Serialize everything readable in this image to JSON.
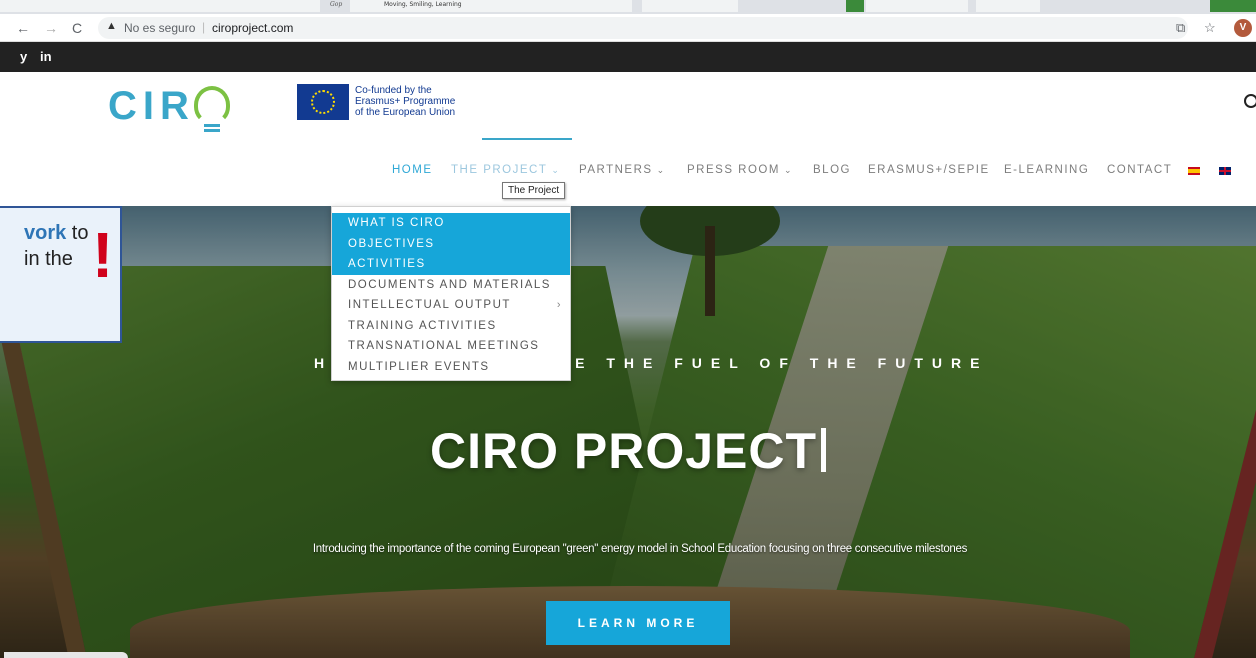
{
  "browser": {
    "tab_snippet": "Moving, Smiling, Learning",
    "tab_snippet2": "Gop",
    "back_icon": "←",
    "forward_icon": "→",
    "reload_icon": "C",
    "security_icon": "▲",
    "insecure_label": "No es seguro",
    "url_separator": "|",
    "url": "ciroproject.com",
    "translate_icon": "⧉",
    "bookmark_icon": "☆",
    "profile_initial": "V"
  },
  "social": {
    "twitter": "y",
    "linkedin": "in"
  },
  "header": {
    "logo_text": "CIR",
    "eu_line1": "Co-funded by the",
    "eu_line2": "Erasmus+ Programme",
    "eu_line3": "of the European Union"
  },
  "nav": {
    "items": [
      {
        "label": "HOME"
      },
      {
        "label": "THE PROJECT"
      },
      {
        "label": "PARTNERS"
      },
      {
        "label": "PRESS ROOM"
      },
      {
        "label": "BLOG"
      },
      {
        "label": "ERASMUS+/SEPIE"
      },
      {
        "label": "E-LEARNING"
      },
      {
        "label": "CONTACT"
      }
    ],
    "tooltip": "The Project"
  },
  "dropdown": {
    "items": [
      {
        "label": "WHAT IS CIRO"
      },
      {
        "label": "OBJECTIVES"
      },
      {
        "label": "ACTIVITIES"
      },
      {
        "label": "DOCUMENTS AND MATERIALS"
      },
      {
        "label": "INTELLECTUAL OUTPUT"
      },
      {
        "label": "TRAINING ACTIVITIES"
      },
      {
        "label": "TRANSNATIONAL MEETINGS"
      },
      {
        "label": "MULTIPLIER EVENTS"
      }
    ],
    "submenu_arrow": "›"
  },
  "hero": {
    "subtitle_left": "H",
    "subtitle_right": "E THE FUEL OF THE FUTURE",
    "title": "CIRO PROJECT",
    "description": "Introducing the importance of the coming European \"green\" energy model in School Education focusing on three consecutive milestones",
    "cta": "LEARN MORE"
  },
  "callout": {
    "keyword": "vork",
    "line1_rest": " to",
    "line2": "in the",
    "mark": "!"
  },
  "colors": {
    "accent": "#16a6d9",
    "nav_active": "#2fa8d6",
    "social_bar": "#222222",
    "callout_border": "#2f5597",
    "callout_keyword": "#2e75b6",
    "alert": "#d0021b"
  }
}
